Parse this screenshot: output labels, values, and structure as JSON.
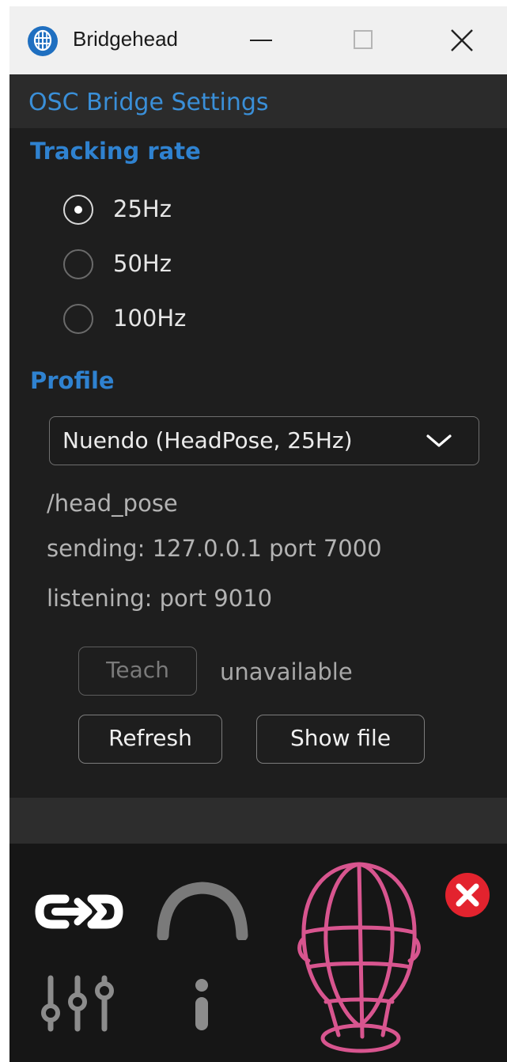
{
  "window": {
    "title": "Bridgehead",
    "controls": {
      "minimize": "minimize",
      "maximize": "maximize",
      "close": "close"
    }
  },
  "header": {
    "title": "OSC Bridge Settings"
  },
  "tracking": {
    "label": "Tracking rate",
    "options": [
      {
        "label": "25Hz",
        "selected": true
      },
      {
        "label": "50Hz",
        "selected": false
      },
      {
        "label": "100Hz",
        "selected": false
      }
    ]
  },
  "profile": {
    "label": "Profile",
    "selected": "Nuendo (HeadPose, 25Hz)",
    "address": "/head_pose",
    "sending": "sending: 127.0.0.1 port 7000",
    "listening": "listening: port 9010"
  },
  "actions": {
    "teach": "Teach",
    "teach_status": "unavailable",
    "refresh": "Refresh",
    "show_file": "Show file"
  },
  "footer": {
    "icons": [
      "link-arrows-icon",
      "headphones-arc-icon",
      "mixer-sliders-icon",
      "info-icon",
      "wireframe-head-icon",
      "error-badge-icon"
    ]
  },
  "colors": {
    "accent": "#2f82d0",
    "head": "#d8558f",
    "error": "#e3232e",
    "background": "#1e1e1e"
  }
}
